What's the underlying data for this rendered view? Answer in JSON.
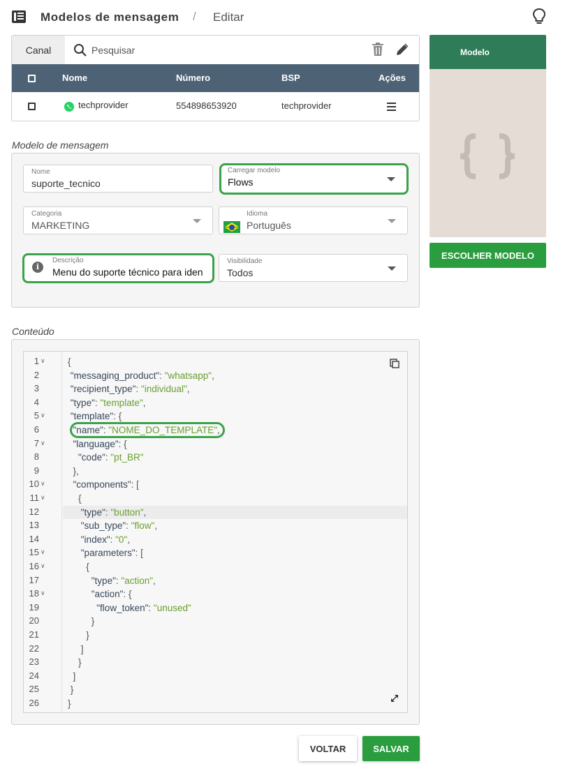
{
  "header": {
    "title": "Modelos de mensagem",
    "separator": "/",
    "subtitle": "Editar"
  },
  "channel_table": {
    "tab_label": "Canal",
    "search_placeholder": "Pesquisar",
    "columns": [
      "Nome",
      "Número",
      "BSP",
      "Ações"
    ],
    "rows": [
      {
        "nome": "techprovider",
        "numero": "554898653920",
        "bsp": "techprovider",
        "icon": "whatsapp-icon"
      }
    ]
  },
  "template_section": {
    "label": "Modelo de mensagem",
    "nome": {
      "label": "Nome",
      "value": "suporte_tecnico"
    },
    "carregar_modelo": {
      "label": "Carregar modelo",
      "value": "Flows"
    },
    "categoria": {
      "label": "Categoria",
      "value": "MARKETING"
    },
    "idioma": {
      "label": "Idioma",
      "value": "Português",
      "flag": "brazil-flag-icon"
    },
    "descricao": {
      "label": "Descrição",
      "value": "Menu do suporte técnico para iden"
    },
    "visibilidade": {
      "label": "Visibilidade",
      "value": "Todos"
    }
  },
  "content_section": {
    "label": "Conteúdo",
    "line_numbers": [
      "1",
      "2",
      "3",
      "4",
      "5",
      "6",
      "7",
      "8",
      "9",
      "10",
      "11",
      "12",
      "13",
      "14",
      "15",
      "16",
      "17",
      "18",
      "19",
      "20",
      "21",
      "22",
      "23",
      "24",
      "25",
      "26"
    ],
    "active_line": 12,
    "code": [
      {
        "ind": "",
        "t": [
          [
            "p",
            "{"
          ]
        ]
      },
      {
        "ind": " ",
        "t": [
          [
            "k",
            "\"messaging_product\""
          ],
          [
            "p",
            ": "
          ],
          [
            "s",
            "\"whatsapp\""
          ],
          [
            "p",
            ","
          ]
        ]
      },
      {
        "ind": " ",
        "t": [
          [
            "k",
            "\"recipient_type\""
          ],
          [
            "p",
            ": "
          ],
          [
            "s",
            "\"individual\""
          ],
          [
            "p",
            ","
          ]
        ]
      },
      {
        "ind": " ",
        "t": [
          [
            "k",
            "\"type\""
          ],
          [
            "p",
            ": "
          ],
          [
            "s",
            "\"template\""
          ],
          [
            "p",
            ","
          ]
        ]
      },
      {
        "ind": " ",
        "t": [
          [
            "k",
            "\"template\""
          ],
          [
            "p",
            ": {"
          ]
        ]
      },
      {
        "ind": "  ",
        "t": [
          [
            "k",
            "\"name\""
          ],
          [
            "p",
            ": "
          ],
          [
            "s",
            "\"NOME_DO_TEMPLATE\""
          ],
          [
            "p",
            ","
          ]
        ]
      },
      {
        "ind": "  ",
        "t": [
          [
            "k",
            "\"language\""
          ],
          [
            "p",
            ": {"
          ]
        ]
      },
      {
        "ind": "    ",
        "t": [
          [
            "k",
            "\"code\""
          ],
          [
            "p",
            ": "
          ],
          [
            "s",
            "\"pt_BR\""
          ]
        ]
      },
      {
        "ind": "  ",
        "t": [
          [
            "p",
            "},"
          ]
        ]
      },
      {
        "ind": "  ",
        "t": [
          [
            "k",
            "\"components\""
          ],
          [
            "p",
            ": ["
          ]
        ]
      },
      {
        "ind": "    ",
        "t": [
          [
            "p",
            "{"
          ]
        ]
      },
      {
        "ind": "     ",
        "t": [
          [
            "k",
            "\"type\""
          ],
          [
            "p",
            ": "
          ],
          [
            "s",
            "\"button\""
          ],
          [
            "p",
            ","
          ]
        ]
      },
      {
        "ind": "     ",
        "t": [
          [
            "k",
            "\"sub_type\""
          ],
          [
            "p",
            ": "
          ],
          [
            "s",
            "\"flow\""
          ],
          [
            "p",
            ","
          ]
        ]
      },
      {
        "ind": "     ",
        "t": [
          [
            "k",
            "\"index\""
          ],
          [
            "p",
            ": "
          ],
          [
            "s",
            "\"0\""
          ],
          [
            "p",
            ","
          ]
        ]
      },
      {
        "ind": "     ",
        "t": [
          [
            "k",
            "\"parameters\""
          ],
          [
            "p",
            ": ["
          ]
        ]
      },
      {
        "ind": "       ",
        "t": [
          [
            "p",
            "{"
          ]
        ]
      },
      {
        "ind": "         ",
        "t": [
          [
            "k",
            "\"type\""
          ],
          [
            "p",
            ": "
          ],
          [
            "s",
            "\"action\""
          ],
          [
            "p",
            ","
          ]
        ]
      },
      {
        "ind": "         ",
        "t": [
          [
            "k",
            "\"action\""
          ],
          [
            "p",
            ": {"
          ]
        ]
      },
      {
        "ind": "           ",
        "t": [
          [
            "k",
            "\"flow_token\""
          ],
          [
            "p",
            ": "
          ],
          [
            "s",
            "\"unused\""
          ]
        ]
      },
      {
        "ind": "         ",
        "t": [
          [
            "p",
            "}"
          ]
        ]
      },
      {
        "ind": "       ",
        "t": [
          [
            "p",
            "}"
          ]
        ]
      },
      {
        "ind": "     ",
        "t": [
          [
            "p",
            "]"
          ]
        ]
      },
      {
        "ind": "    ",
        "t": [
          [
            "p",
            "}"
          ]
        ]
      },
      {
        "ind": "  ",
        "t": [
          [
            "p",
            "]"
          ]
        ]
      },
      {
        "ind": " ",
        "t": [
          [
            "p",
            "}"
          ]
        ]
      },
      {
        "ind": "",
        "t": [
          [
            "p",
            "}"
          ]
        ]
      }
    ],
    "foldable_lines": [
      1,
      5,
      7,
      10,
      11,
      15,
      16,
      18
    ]
  },
  "actions": {
    "voltar": "VOLTAR",
    "salvar": "SALVAR"
  },
  "preview": {
    "header": "Modelo",
    "placeholder_icon": "curly-braces-icon",
    "choose_button": "ESCOLHER MODELO"
  },
  "colors": {
    "table_header": "#4d6375",
    "accent_green": "#2a9d3e",
    "highlight_green": "#3aa34a",
    "preview_header": "#2e7d58",
    "preview_bg": "#e5ddd5",
    "json_key": "#37475a",
    "json_string": "#6a9e2e"
  }
}
